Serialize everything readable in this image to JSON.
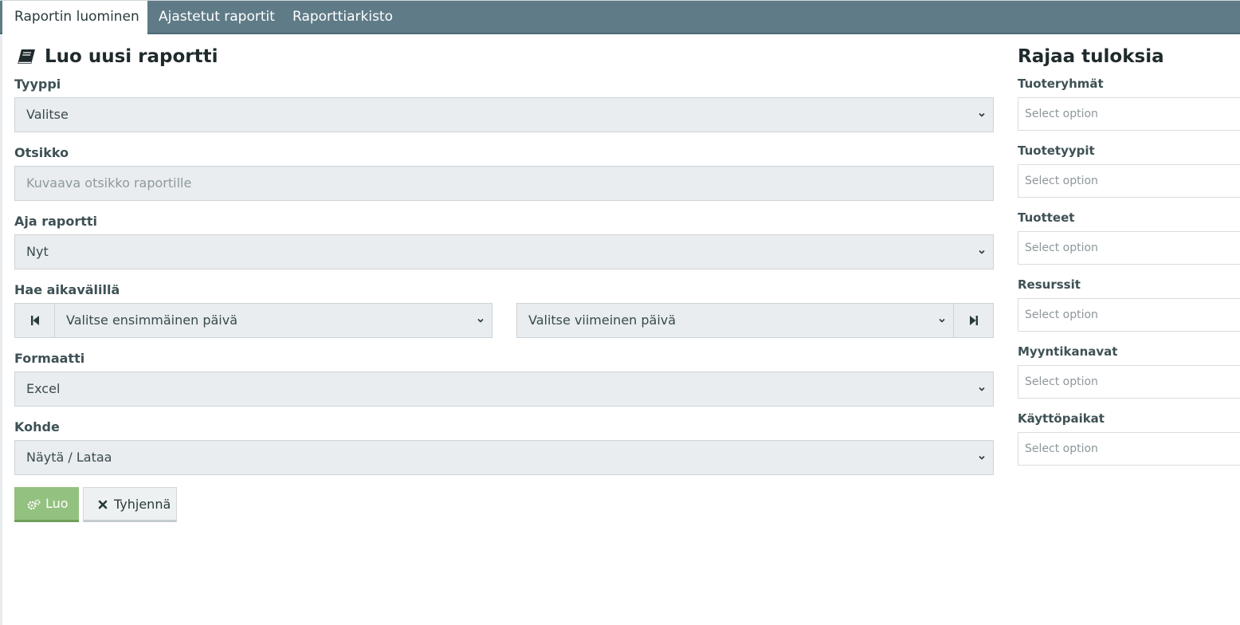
{
  "tabs": [
    {
      "label": "Raportin luominen",
      "active": true
    },
    {
      "label": "Ajastetut raportit",
      "active": false
    },
    {
      "label": "Raporttiarkisto",
      "active": false
    }
  ],
  "form": {
    "title": "Luo uusi raportti",
    "title_icon": "book-icon",
    "type": {
      "label": "Tyyppi",
      "value": "Valitse"
    },
    "subject": {
      "label": "Otsikko",
      "placeholder": "Kuvaava otsikko raportille"
    },
    "run": {
      "label": "Aja raportti",
      "value": "Nyt"
    },
    "range": {
      "label": "Hae aikavälillä",
      "start": "Valitse ensimmäinen päivä",
      "end": "Valitse viimeinen päivä"
    },
    "format": {
      "label": "Formaatti",
      "value": "Excel"
    },
    "target": {
      "label": "Kohde",
      "value": "Näytä / Lataa"
    },
    "create_label": "Luo",
    "clear_label": "Tyhjennä"
  },
  "filters": {
    "title": "Rajaa tuloksia",
    "items": [
      {
        "label": "Tuoteryhmät",
        "placeholder": "Select option"
      },
      {
        "label": "Tuotetyypit",
        "placeholder": "Select option"
      },
      {
        "label": "Tuotteet",
        "placeholder": "Select option"
      },
      {
        "label": "Resurssit",
        "placeholder": "Select option"
      },
      {
        "label": "Myyntikanavat",
        "placeholder": "Select option"
      },
      {
        "label": "Käyttöpaikat",
        "placeholder": "Select option"
      }
    ]
  },
  "colors": {
    "tabbar": "#5f7b87",
    "field_bg": "#e9edf0",
    "create_button": "#93c17f"
  }
}
